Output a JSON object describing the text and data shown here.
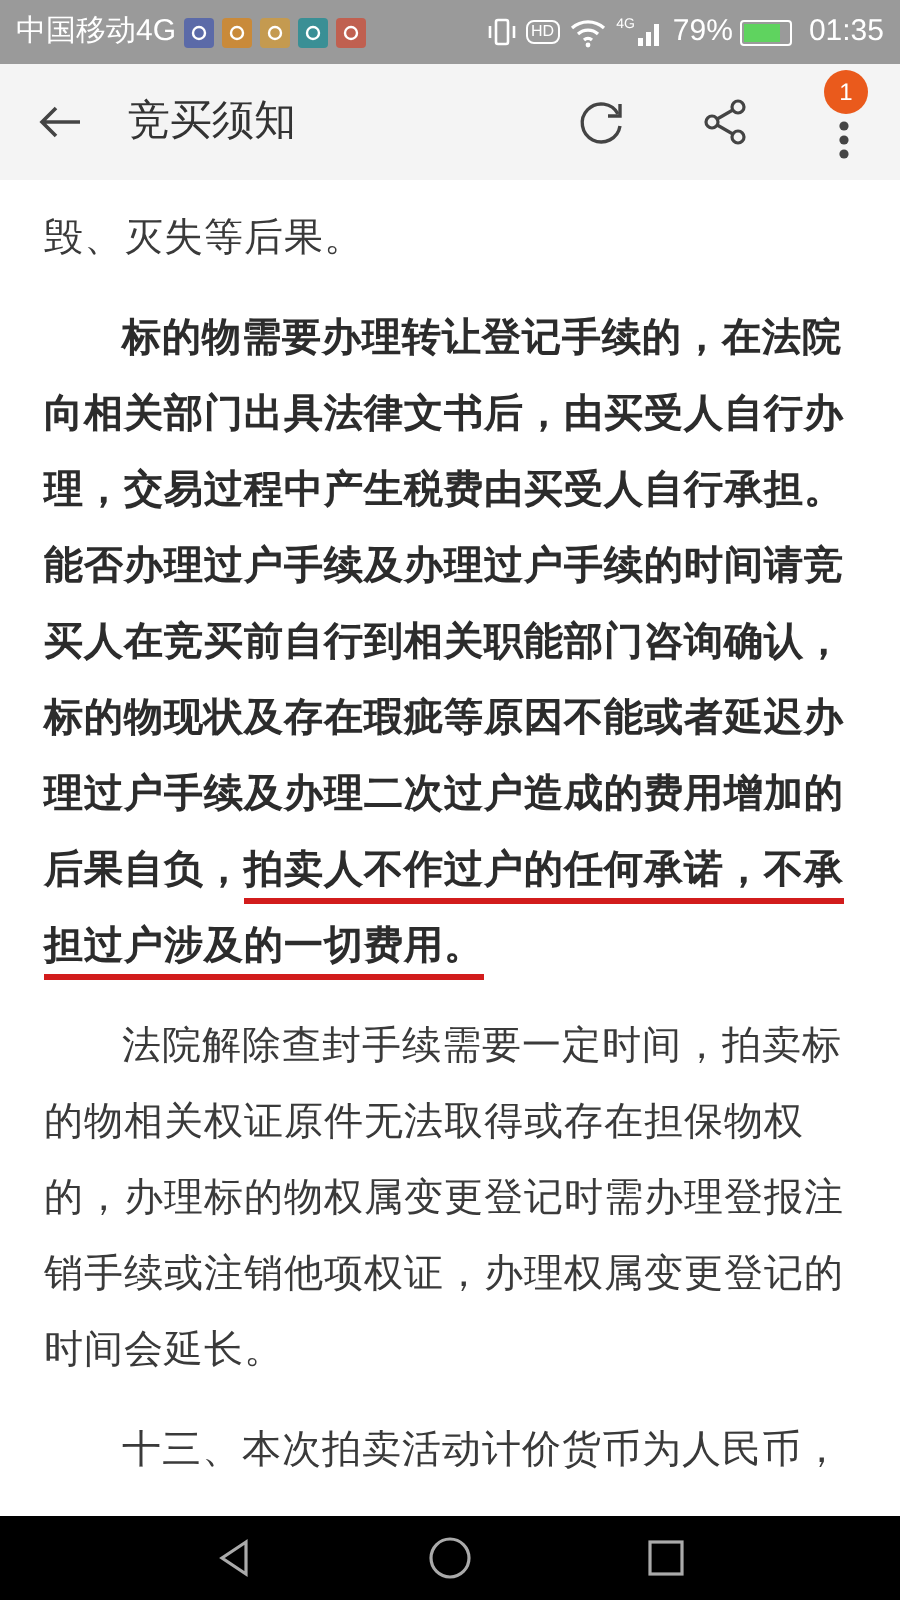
{
  "status_bar": {
    "carrier": "中国移动4G",
    "hd_label": "HD",
    "network": "4G",
    "battery_text": "79%",
    "battery": {
      "level": 0.79
    },
    "time": "01:35"
  },
  "header": {
    "title": "竞买须知",
    "badge": "1"
  },
  "paragraphs": [
    {
      "bold": false,
      "indent": false,
      "segments": [
        {
          "text": "毁、灭失等后果。",
          "underlined": false
        }
      ]
    },
    {
      "bold": true,
      "indent": true,
      "segments": [
        {
          "text": "标的物需要办理转让登记手续的，在法院向相关部门出具法律文书后，由买受人自行办理，交易过程中产生税费由买受人自行承担。能否办理过户手续及办理过户手续的时间请竞买人在竞买前自行到相关职能部门咨询确认，标的物现状及存在瑕疵等原因不能或者延迟办理过户手续及办理二次过户造成的费用增加的后果自负，",
          "underlined": false
        },
        {
          "text": "拍卖人不作过户的任何承诺，不承担过户涉及的一切费用。",
          "underlined": true
        }
      ]
    },
    {
      "bold": false,
      "indent": true,
      "segments": [
        {
          "text": "法院解除查封手续需要一定时间，拍卖标的物相关权证原件无法取得或存在担保物权的，办理标的物权属变更登记时需办理登报注销手续或注销他项权证，办理权属变更登记的时间会延长。",
          "underlined": false
        }
      ]
    },
    {
      "bold": false,
      "indent": true,
      "segments": [
        {
          "text": "十三、本次拍卖活动计价货币为人民币，",
          "underlined": false
        }
      ]
    }
  ]
}
